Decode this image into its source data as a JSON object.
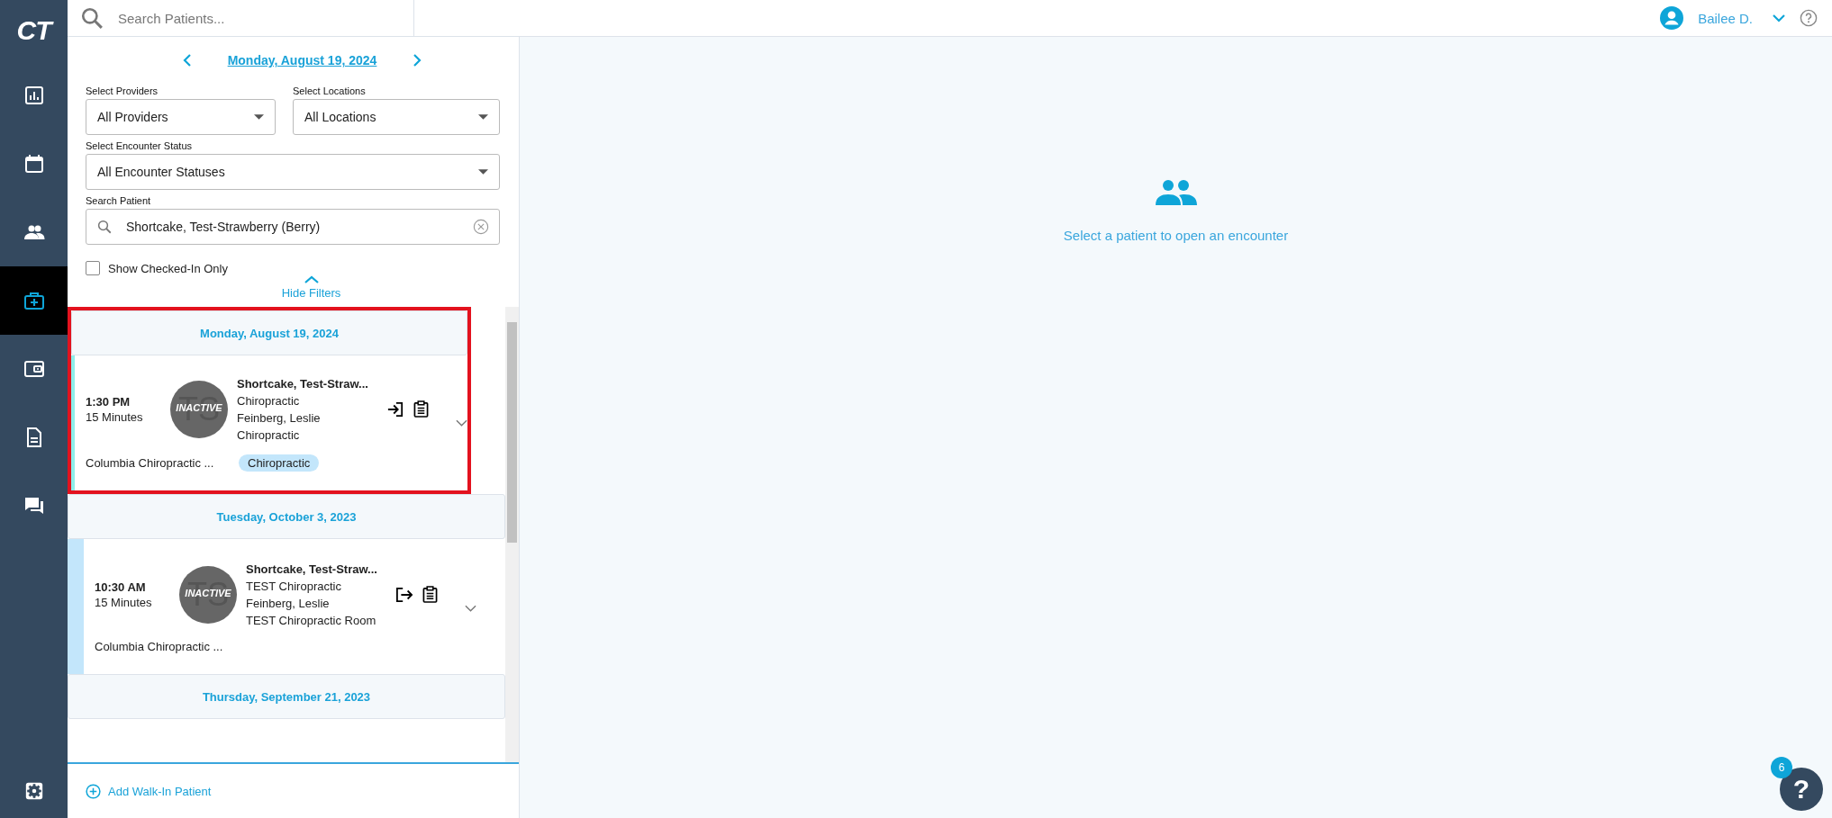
{
  "logo": "CT",
  "nav": [
    {
      "selected": false
    },
    {
      "selected": false
    },
    {
      "selected": false
    },
    {
      "selected": true
    },
    {
      "selected": false
    },
    {
      "selected": false
    },
    {
      "selected": false
    }
  ],
  "top_search": {
    "placeholder": "Search Patients..."
  },
  "user": {
    "name": "Bailee D."
  },
  "date_nav": {
    "date": "Monday, August 19, 2024"
  },
  "filters": [
    {
      "label": "Select Providers",
      "value": "All Providers",
      "kind": "select"
    },
    {
      "label": "Select Locations",
      "value": "All Locations",
      "kind": "select"
    },
    {
      "label": "Select Encounter Status",
      "value": "All Encounter Statuses",
      "kind": "select"
    },
    {
      "label": "Search Patient",
      "value": "Shortcake, Test-Strawberry (Berry)",
      "kind": "search"
    }
  ],
  "checked_in_only": {
    "label": "Show Checked-In Only",
    "checked": false
  },
  "hide_filters": "Hide Filters",
  "days": [
    {
      "date": "Monday, August 19, 2024",
      "highlighted": true,
      "encounters": [
        {
          "time": "1:30 PM",
          "duration": "15 Minutes",
          "initials": "TS",
          "badge": "INACTIVE",
          "name": "Shortcake, Test-Straw...",
          "lines": [
            "Chiropractic",
            "Feinberg, Leslie",
            "Chiropractic"
          ],
          "location": "Columbia Chiropractic ...",
          "tag": "Chiropractic",
          "kind": "check-in",
          "color": "#8eeeea"
        }
      ]
    },
    {
      "date": "Tuesday, October 3, 2023",
      "highlighted": false,
      "encounters": [
        {
          "time": "10:30 AM",
          "duration": "15 Minutes",
          "initials": "TS",
          "badge": "INACTIVE",
          "name": "Shortcake, Test-Straw...",
          "lines": [
            "TEST Chiropractic",
            "Feinberg, Leslie",
            "TEST Chiropractic Room"
          ],
          "location": "Columbia Chiropractic ...",
          "kind": "check-out",
          "color": "#c3e6fb"
        }
      ]
    },
    {
      "date": "Thursday, September 21, 2023",
      "highlighted": false
    }
  ],
  "add_walk_in": "Add Walk-In Patient",
  "empty_state": "Select a patient to open an encounter",
  "help": {
    "label": "?",
    "count": "6"
  }
}
